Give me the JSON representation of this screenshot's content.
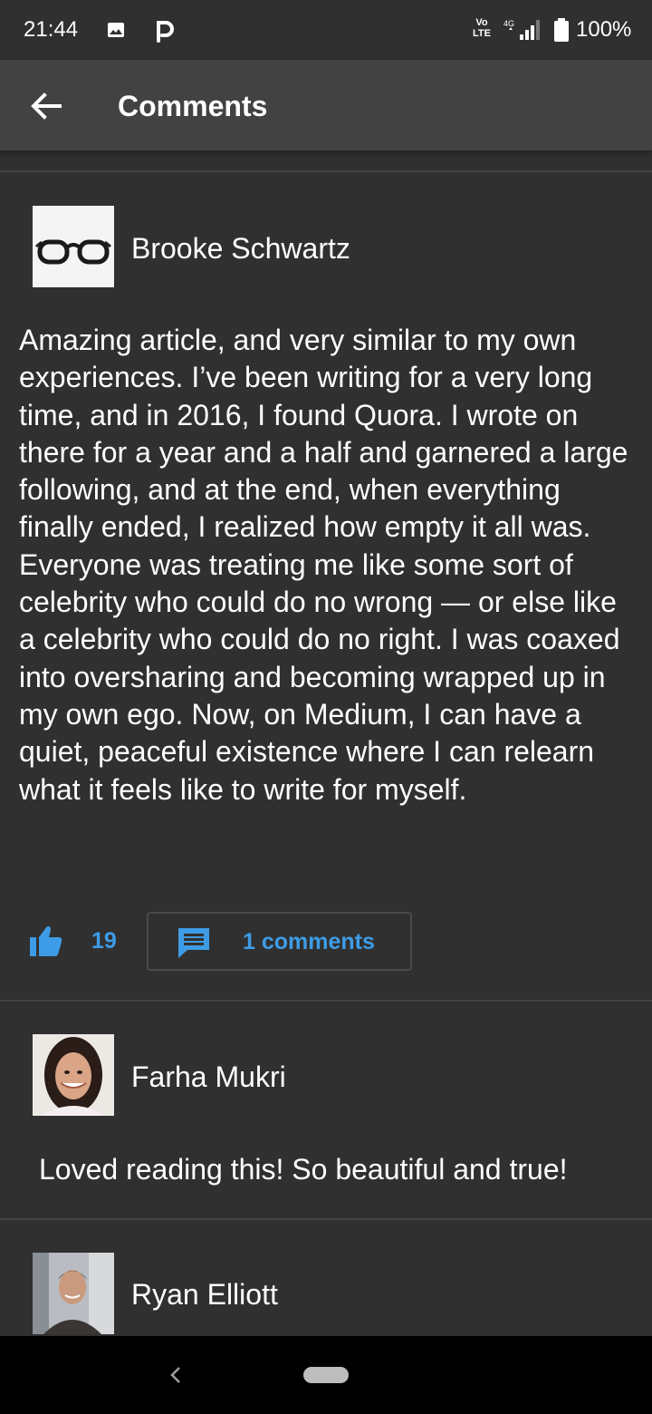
{
  "status_bar": {
    "time": "21:44",
    "battery": "100%",
    "network_top": "Vo",
    "network_bottom": "LTE",
    "signal_label": "4G",
    "icons": [
      "image-icon",
      "p-icon",
      "signal-icon",
      "battery-icon"
    ]
  },
  "app_bar": {
    "title": "Comments",
    "back_icon": "arrow-left-icon"
  },
  "comments": [
    {
      "author": "Brooke Schwartz",
      "avatar": "glasses-avatar",
      "text": "Amazing article, and very similar to my own experiences. I’ve been writing for a very long time, and in 2016, I found Quora. I wrote on there for a year and a half and garnered a large following, and at the end, when everything finally ended, I realized how empty it all was. Everyone was treating me like some sort of celebrity who could do no wrong — or else like a celebrity who could do no right. I was coaxed into oversharing and becoming wrapped up in my own ego. Now, on Medium, I can have a quiet, peaceful existence where I can relearn what it feels like to write for myself.",
      "likes": "19",
      "comments_label": "1 comments"
    },
    {
      "author": "Farha Mukri",
      "avatar": "woman-photo-avatar",
      "text": "Loved reading this! So beautiful and true!"
    },
    {
      "author": "Ryan Elliott",
      "avatar": "man-photo-avatar"
    }
  ],
  "colors": {
    "background": "#303030",
    "app_bar": "#424242",
    "accent": "#3e9ce6",
    "divider": "#434343"
  }
}
